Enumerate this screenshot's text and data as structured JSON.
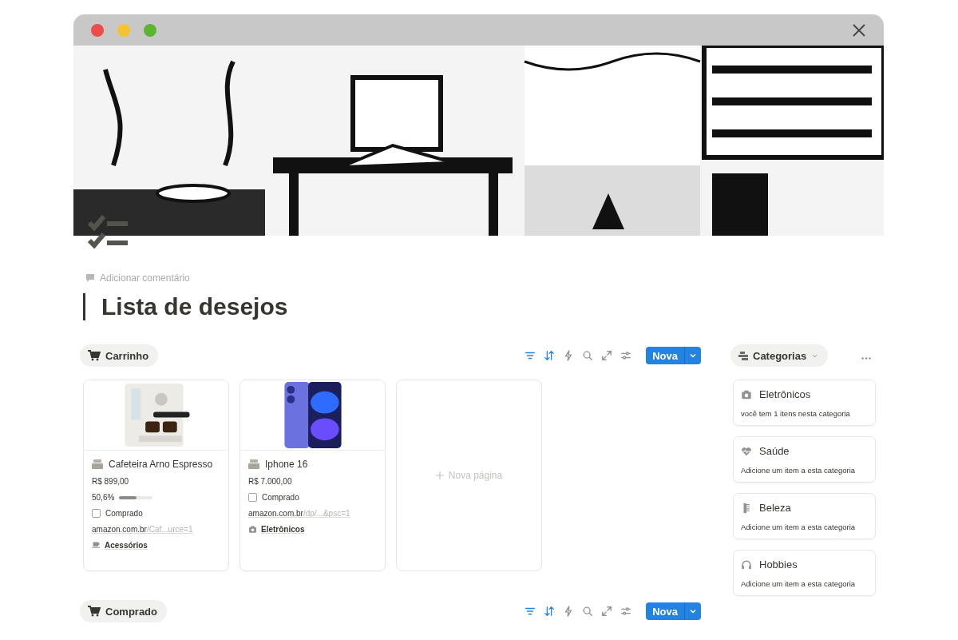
{
  "page": {
    "comment": "Adicionar comentário",
    "title": "Lista de desejos"
  },
  "views": [
    {
      "label": "Carrinho",
      "toolbar": [
        {
          "kind": "filter",
          "active": true
        },
        {
          "kind": "sort",
          "active": true
        },
        {
          "kind": "bolt",
          "active": false
        },
        {
          "kind": "search",
          "active": false
        },
        {
          "kind": "expand",
          "active": false
        },
        {
          "kind": "sliders",
          "active": false
        }
      ],
      "new_button": "Nova",
      "cards": [
        {
          "title": "Cafeteira Arno Espresso",
          "price": "R$ 899,00",
          "progress": {
            "text": "50,6%",
            "level": 0.506
          },
          "purchased": false,
          "purchased_label": "Comprado",
          "link_domain": "amazon.com.br",
          "link_path": "/Caf...urce=1",
          "category": {
            "kind": "cup",
            "label": "Acessórios"
          }
        },
        {
          "title": "Iphone 16",
          "price": "R$ 7.000,00",
          "purchased": false,
          "purchased_label": "Comprado",
          "link_domain": "amazon.com.br",
          "link_path": "/dp/...&psc=1",
          "category": {
            "kind": "camera",
            "label": "Eletrônicos"
          }
        }
      ],
      "new_page": "Nova página"
    },
    {
      "label": "Comprado",
      "toolbar": [
        {
          "kind": "filter",
          "active": true
        },
        {
          "kind": "sort",
          "active": true
        },
        {
          "kind": "bolt",
          "active": false
        },
        {
          "kind": "search",
          "active": false
        },
        {
          "kind": "expand",
          "active": false
        },
        {
          "kind": "sliders",
          "active": false
        }
      ],
      "new_button": "Nova"
    }
  ],
  "categories": {
    "label": "Categorias",
    "items": [
      {
        "kind": "camera",
        "name": "Eletrônicos",
        "note": "você tem 1 itens nesta categoria"
      },
      {
        "kind": "heart",
        "name": "Saúde",
        "note": "Adicione um item a esta categoria"
      },
      {
        "kind": "comb",
        "name": "Beleza",
        "note": "Adicione um item a esta categoria"
      },
      {
        "kind": "headphones",
        "name": "Hobbies",
        "note": "Adicione um item a esta categoria"
      }
    ]
  }
}
